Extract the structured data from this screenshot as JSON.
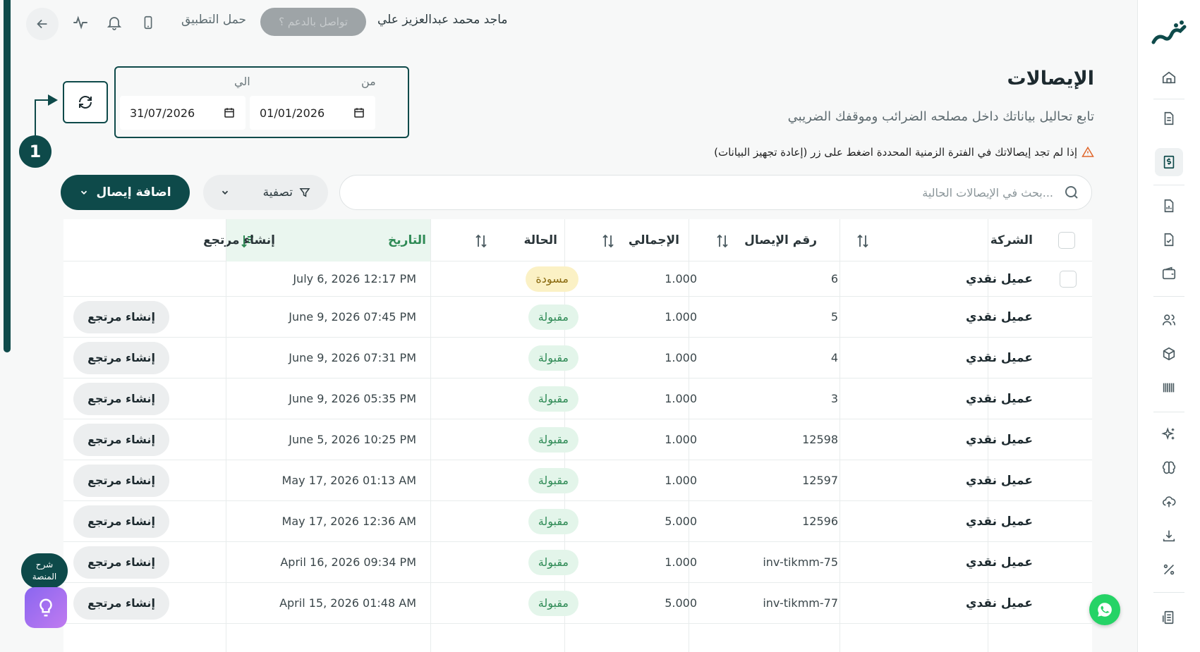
{
  "topbar": {
    "app_link": "حمل التطبيق",
    "contact_button": "تواصل بالدعم ؟",
    "user_name": "ماجد محمد عبدالعزيز علي"
  },
  "date_range": {
    "from_label": "من",
    "to_label": "الي",
    "from_value": "01/01/2026",
    "to_value": "31/07/2026"
  },
  "step_badge": "1",
  "page": {
    "title": "الإيصالات",
    "subtitle": "تابع تحاليل بياناتك داخل مصلحه الضرائب  وموقفك الضريبي",
    "warning": "إذا لم تجد إيصالاتك في الفترة الزمنية المحددة اضغط على زر (إعادة تجهيز البيانات)"
  },
  "toolbar": {
    "add_label": "اضافة إيصال",
    "filter_label": "تصفية",
    "search_placeholder": "بحث في الإيصالات الحالية..."
  },
  "table": {
    "headers": {
      "company": "الشركة",
      "receipt_no": "رقم الإيصال",
      "total": "الإجمالي",
      "status": "الحالة",
      "date": "التاريخ",
      "create_return": "إنشاء مرتجع"
    },
    "rows": [
      {
        "company": "عميل نقدي",
        "receipt_no": "6",
        "total": "1.000",
        "status": "مسودة",
        "status_type": "draft",
        "date": "July 6, 2026 12:17 PM",
        "action": ""
      },
      {
        "company": "عميل نقدي",
        "receipt_no": "5",
        "total": "1.000",
        "status": "مقبولة",
        "status_type": "ok",
        "date": "June 9, 2026 07:45 PM",
        "action": "إنشاء مرتجع"
      },
      {
        "company": "عميل نقدي",
        "receipt_no": "4",
        "total": "1.000",
        "status": "مقبولة",
        "status_type": "ok",
        "date": "June 9, 2026 07:31 PM",
        "action": "إنشاء مرتجع"
      },
      {
        "company": "عميل نقدي",
        "receipt_no": "3",
        "total": "1.000",
        "status": "مقبولة",
        "status_type": "ok",
        "date": "June 9, 2026 05:35 PM",
        "action": "إنشاء مرتجع"
      },
      {
        "company": "عميل نقدي",
        "receipt_no": "12598",
        "total": "1.000",
        "status": "مقبولة",
        "status_type": "ok",
        "date": "June 5, 2026 10:25 PM",
        "action": "إنشاء مرتجع"
      },
      {
        "company": "عميل نقدي",
        "receipt_no": "12597",
        "total": "1.000",
        "status": "مقبولة",
        "status_type": "ok",
        "date": "May 17, 2026 01:13 AM",
        "action": "إنشاء مرتجع"
      },
      {
        "company": "عميل نقدي",
        "receipt_no": "12596",
        "total": "5.000",
        "status": "مقبولة",
        "status_type": "ok",
        "date": "May 17, 2026 12:36 AM",
        "action": "إنشاء مرتجع"
      },
      {
        "company": "عميل نقدي",
        "receipt_no": "inv-tikmm-75",
        "total": "1.000",
        "status": "مقبولة",
        "status_type": "ok",
        "date": "April 16, 2026 09:34 PM",
        "action": "إنشاء مرتجع"
      },
      {
        "company": "عميل نقدي",
        "receipt_no": "inv-tikmm-77",
        "total": "5.000",
        "status": "مقبولة",
        "status_type": "ok",
        "date": "April 15, 2026 01:48 AM",
        "action": "إنشاء مرتجع"
      }
    ]
  },
  "help": {
    "label_line1": "شرح",
    "label_line2": "المنصة"
  },
  "sidebar": {
    "icons": [
      "home-icon",
      "document-icon",
      "receipt-icon",
      "chart-icon",
      "file-check-icon",
      "wallet-icon",
      "users-icon",
      "box-icon",
      "barcode-icon",
      "sparkles-icon",
      "brain-icon",
      "cloud-upload-icon",
      "download-icon",
      "percent-icon",
      "report-icon"
    ],
    "active": "receipt-icon"
  },
  "colors": {
    "primary": "#0e4a4a",
    "accepted_bg": "#e3f5ea",
    "accepted_text": "#2e8a55",
    "draft_bg": "#fbf1c5",
    "draft_text": "#8a6a10"
  }
}
